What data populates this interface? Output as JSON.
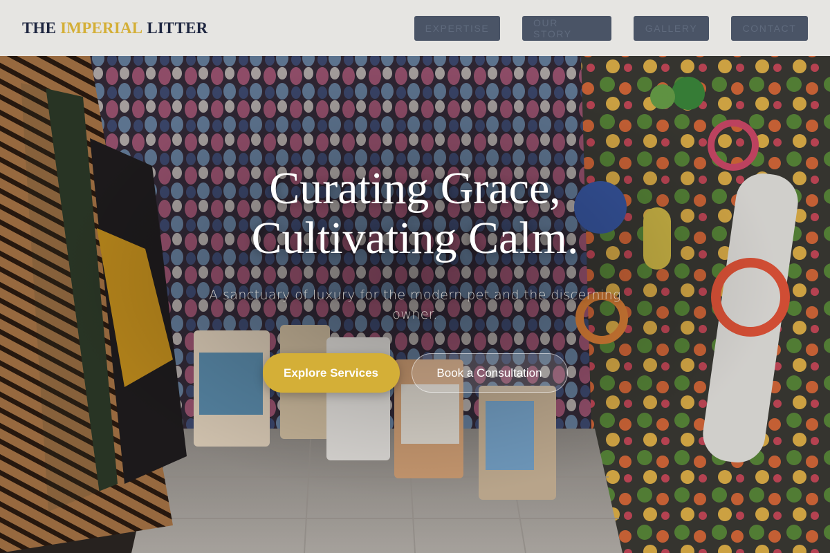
{
  "brand": {
    "part1": "THE",
    "part2": "IMPERIAL",
    "part3": "LITTER",
    "accent_color": "#d4af37",
    "text_color": "#1e2640"
  },
  "nav": {
    "items": [
      {
        "label": "EXPERTISE"
      },
      {
        "label": "OUR STORY"
      },
      {
        "label": "GALLERY"
      },
      {
        "label": "CONTACT"
      }
    ],
    "button_color": "#4a5466"
  },
  "hero": {
    "title_line1": "Curating Grace,",
    "title_line2": "Cultivating Calm.",
    "subtitle": "A sanctuary of luxury for the modern pet and the discerning owner.",
    "primary_cta": "Explore Services",
    "secondary_cta": "Book a Consultation",
    "primary_color": "#d4af37"
  }
}
